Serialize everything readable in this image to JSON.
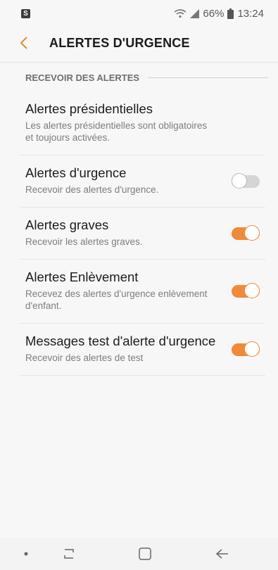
{
  "status_bar": {
    "battery_percent": "66%",
    "time": "13:24",
    "icons": [
      "notification-icon",
      "wifi-icon",
      "signal-icon",
      "battery-icon"
    ]
  },
  "header": {
    "back_icon": "chevron-left-icon",
    "title": "ALERTES D'URGENCE"
  },
  "section": {
    "title": "RECEVOIR DES ALERTES"
  },
  "items": [
    {
      "title": "Alertes présidentielles",
      "subtitle": "Les alertes présidentielles sont obligatoires et toujours activées.",
      "toggle": null
    },
    {
      "title": "Alertes d'urgence",
      "subtitle": "Recevoir des alertes d'urgence.",
      "toggle": "off"
    },
    {
      "title": "Alertes graves",
      "subtitle": "Recevoir les alertes graves.",
      "toggle": "on"
    },
    {
      "title": "Alertes Enlèvement",
      "subtitle": "Recevez des alertes d'urgence enlèvement d'enfant.",
      "toggle": "on"
    },
    {
      "title": "Messages test d'alerte d'urgence",
      "subtitle": "Recevoir des alertes de test",
      "toggle": "on"
    }
  ],
  "nav_bar": {
    "icons": [
      "dot-icon",
      "recents-icon",
      "home-icon",
      "back-arrow-icon"
    ]
  },
  "colors": {
    "accent": "#f08a3a",
    "background": "#f7f7f7"
  }
}
